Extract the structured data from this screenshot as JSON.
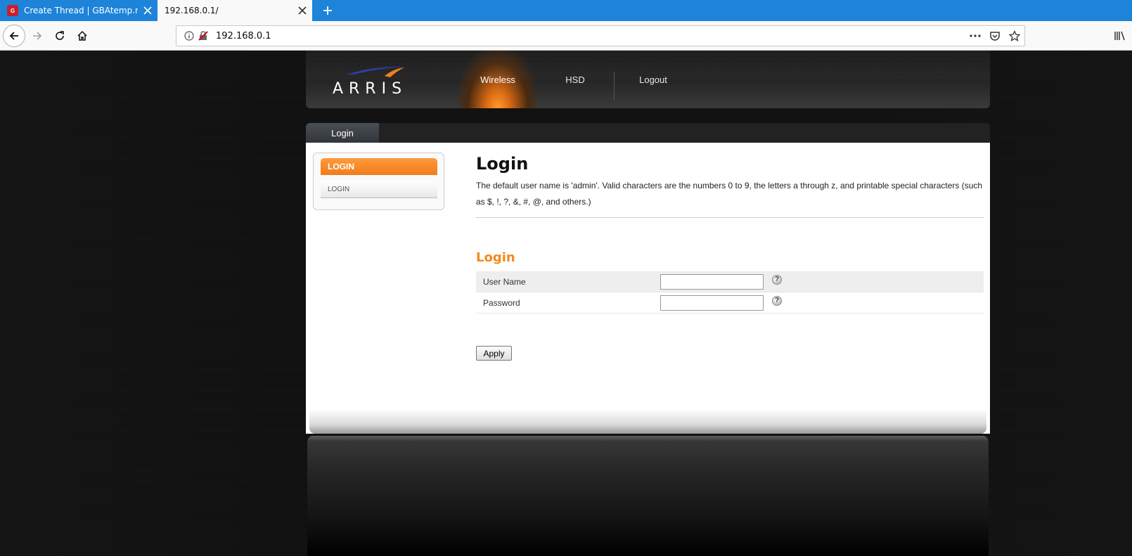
{
  "browser": {
    "tabs": [
      {
        "title": "Create Thread | GBAtemp.net -",
        "favicon": "gbatemp-icon",
        "active": false
      },
      {
        "title": "192.168.0.1/",
        "active": true
      }
    ],
    "url": "192.168.0.1",
    "icons": {
      "back": "back-arrow-icon",
      "forward": "forward-arrow-icon",
      "reload": "reload-icon",
      "home": "home-icon",
      "info": "info-icon",
      "insecure": "insecure-lock-icon",
      "more": "more-actions-icon",
      "pocket": "pocket-icon",
      "bookmark": "bookmark-star-icon",
      "library": "library-icon"
    }
  },
  "header": {
    "logo_text": "ARRIS",
    "nav": [
      {
        "label": "Wireless",
        "active": true
      },
      {
        "label": "HSD",
        "active": false
      },
      {
        "label": "Logout",
        "active": false
      }
    ]
  },
  "subtabs": [
    {
      "label": "Login"
    }
  ],
  "sidebar": {
    "heading": "LOGIN",
    "items": [
      {
        "label": "LOGIN"
      }
    ]
  },
  "main": {
    "title": "Login",
    "description": "The default user name is 'admin'. Valid characters are the numbers 0 to 9, the letters a through z, and printable special characters (such as $, !, ?, &, #, @, and others.)",
    "section_title": "Login",
    "fields": [
      {
        "label": "User Name",
        "value": ""
      },
      {
        "label": "Password",
        "value": ""
      }
    ],
    "help_glyph": "?",
    "apply_label": "Apply"
  },
  "colors": {
    "accent_orange": "#f28a1e",
    "browser_tabbar": "#1d84d9",
    "header_dark": "#262626"
  }
}
